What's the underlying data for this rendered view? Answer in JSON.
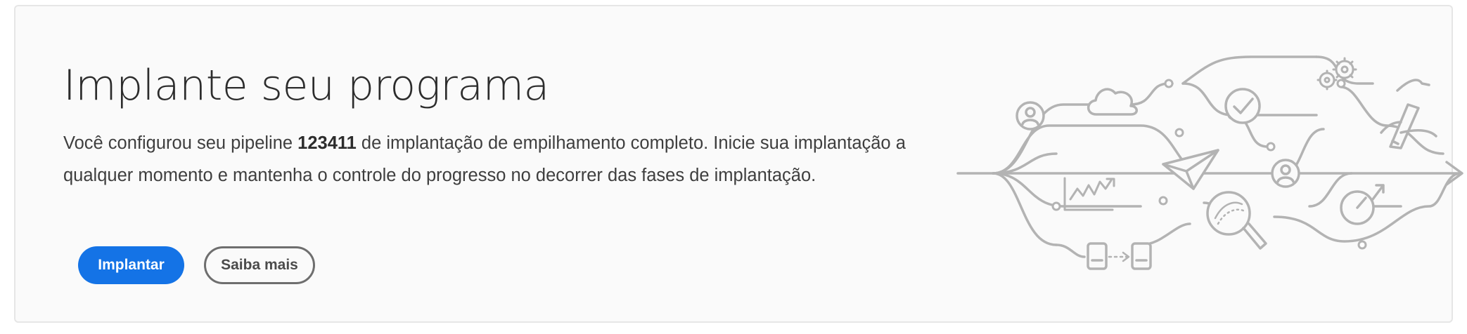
{
  "banner": {
    "title": "Implante seu programa",
    "description_before": "Você configurou seu pipeline ",
    "pipeline_id": "123411",
    "description_after": " de implantação de empilhamento completo. Inicie sua implantação a qualquer momento e mantenha o controle do progresso no decorrer das fases de implantação.",
    "primary_button_label": "Implantar",
    "secondary_button_label": "Saiba mais"
  },
  "colors": {
    "primary": "#1473e6",
    "illustration_stroke": "#b3b3b3"
  },
  "illustration": {
    "icons": [
      "user-icon",
      "cloud-icon",
      "checkmark-icon",
      "gears-icon",
      "pen-hand-icon",
      "paper-plane-icon",
      "line-chart-icon",
      "magnifier-icon",
      "speedometer-icon",
      "document-icon",
      "arrow-icon"
    ]
  }
}
